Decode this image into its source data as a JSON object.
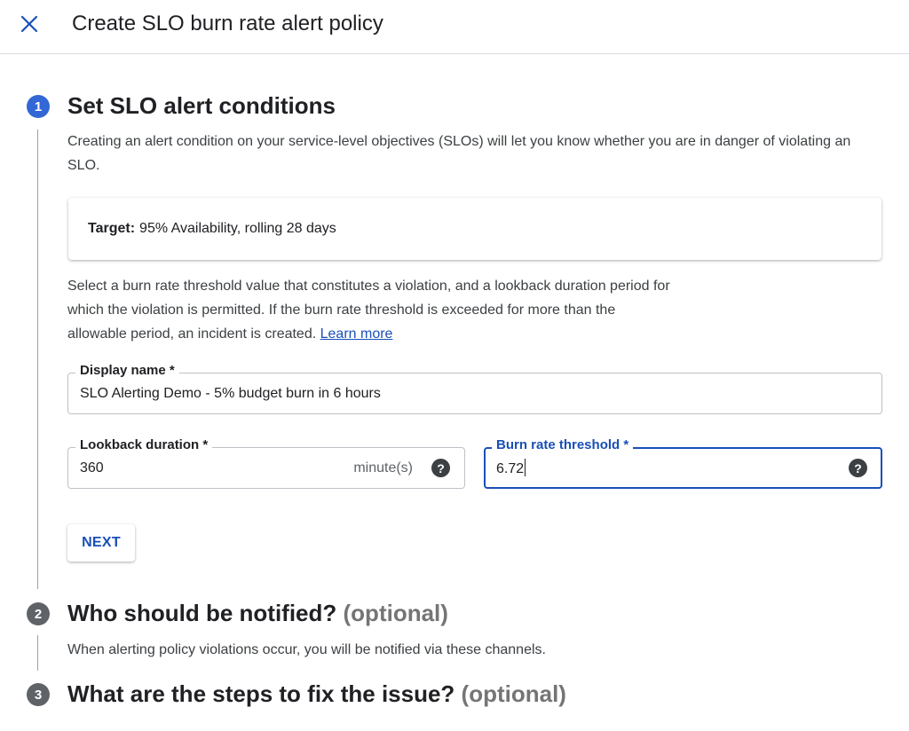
{
  "header": {
    "title": "Create SLO burn rate alert policy"
  },
  "steps": [
    {
      "number": "1",
      "title": "Set SLO alert conditions",
      "description": "Creating an alert condition on your service-level objectives (SLOs) will let you know whether you are in danger of violating an SLO."
    },
    {
      "number": "2",
      "title": "Who should be notified?",
      "optional": "(optional)",
      "description": "When alerting policy violations occur, you will be notified via these channels."
    },
    {
      "number": "3",
      "title": "What are the steps to fix the issue?",
      "optional": "(optional)"
    }
  ],
  "target": {
    "label": "Target:",
    "value": "95% Availability, rolling 28 days"
  },
  "instructions": {
    "text": "Select a burn rate threshold value that constitutes a violation, and a lookback duration period for which the violation is permitted. If the burn rate threshold is exceeded for more than the allowable period, an incident is created.",
    "link": "Learn more"
  },
  "fields": {
    "display_name": {
      "label": "Display name *",
      "value": "SLO Alerting Demo - 5% budget burn in 6 hours"
    },
    "lookback": {
      "label": "Lookback duration *",
      "value": "360",
      "suffix": "minute(s)"
    },
    "burn_rate": {
      "label": "Burn rate threshold *",
      "value": "6.72"
    }
  },
  "buttons": {
    "next": "NEXT"
  },
  "icons": {
    "close": "close-icon",
    "help": "help-icon"
  },
  "colors": {
    "accent": "#1a4fb8",
    "active_step": "#3367d6",
    "inactive_step": "#5f6368"
  }
}
